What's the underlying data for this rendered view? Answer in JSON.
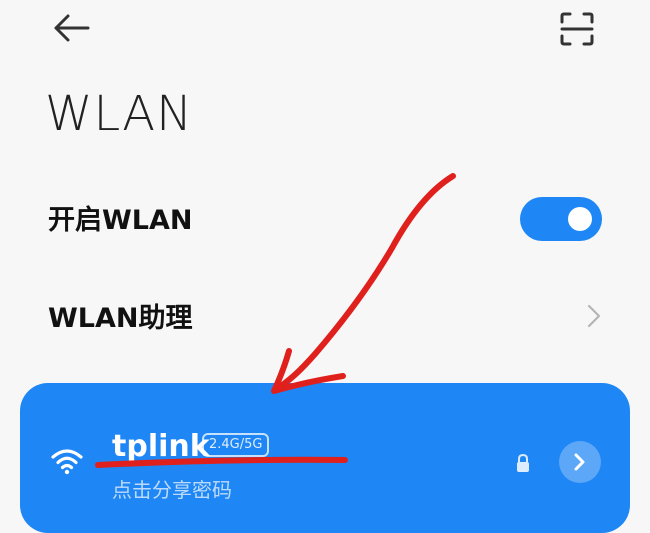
{
  "header": {
    "back_icon": "arrow-left-icon",
    "scan_icon": "scan-icon",
    "title": "WLAN"
  },
  "settings": {
    "enable_label": "开启WLAN",
    "enable_state": true,
    "assistant_label": "WLAN助理"
  },
  "connected_network": {
    "name": "tplink",
    "band_badge": "2.4G/5G",
    "subtitle": "点击分享密码",
    "icons": [
      "wifi-icon",
      "lock-icon",
      "chevron-right-icon"
    ]
  },
  "colors": {
    "accent": "#1e86f5",
    "background": "#f7f7f7",
    "annotation": "#e0201c"
  }
}
